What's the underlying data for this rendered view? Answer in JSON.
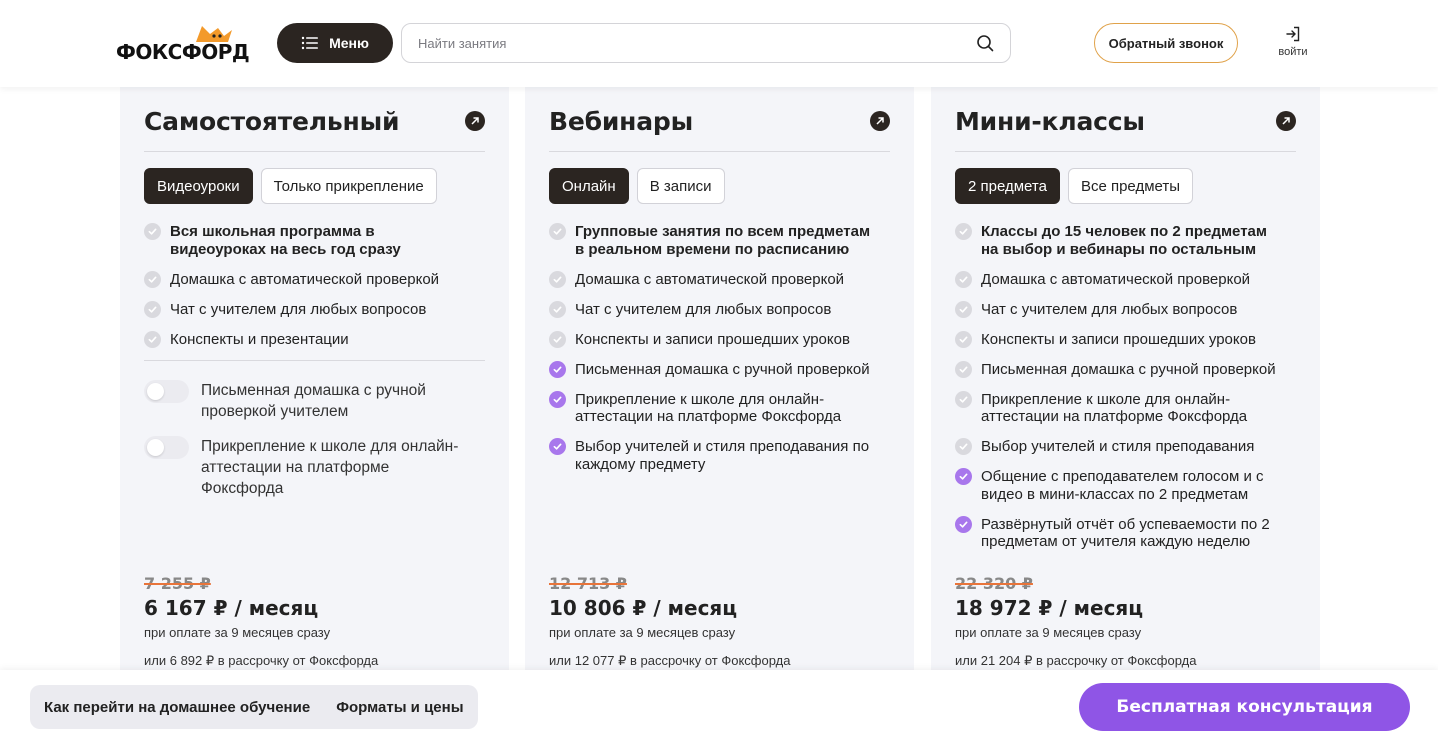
{
  "header": {
    "logo_text": "ФОКСФОРД",
    "menu_label": "Меню",
    "search_placeholder": "Найти занятия",
    "callback_label": "Обратный звонок",
    "login_label": "войти"
  },
  "cards": [
    {
      "title": "Самостоятельный",
      "tabs": [
        {
          "label": "Видеоуроки",
          "active": true
        },
        {
          "label": "Только прикрепление",
          "active": false
        }
      ],
      "features": [
        {
          "text": "Вся школьная программа в видеоуроках на весь год сразу",
          "bold": true,
          "check": "gray"
        },
        {
          "text": "Домашка с автоматической проверкой",
          "bold": false,
          "check": "gray"
        },
        {
          "text": "Чат с учителем для любых вопросов",
          "bold": false,
          "check": "gray"
        },
        {
          "text": "Конспекты и презентации",
          "bold": false,
          "check": "gray"
        }
      ],
      "toggles": [
        {
          "text": "Письменная домашка с ручной проверкой учителем",
          "on": false
        },
        {
          "text": "Прикрепление к школе для онлайн-аттестации на платформе Фоксфорда",
          "on": false
        }
      ],
      "price_old": "7 255 ₽",
      "price_new": "6 167 ₽ / месяц",
      "price_note": "при оплате за 9 месяцев сразу",
      "price_installment": "или 6 892 ₽ в рассрочку от Фоксфорда"
    },
    {
      "title": "Вебинары",
      "tabs": [
        {
          "label": "Онлайн",
          "active": true
        },
        {
          "label": "В записи",
          "active": false
        }
      ],
      "features": [
        {
          "text": "Групповые занятия по всем предметам в реальном времени по расписанию",
          "bold": true,
          "check": "gray"
        },
        {
          "text": "Домашка с автоматической проверкой",
          "bold": false,
          "check": "gray"
        },
        {
          "text": "Чат с учителем для любых вопросов",
          "bold": false,
          "check": "gray"
        },
        {
          "text": "Конспекты и записи прошедших уроков",
          "bold": false,
          "check": "gray"
        },
        {
          "text": "Письменная домашка с ручной проверкой",
          "bold": false,
          "check": "purple"
        },
        {
          "text": "Прикрепление к школе для онлайн-аттестации на платформе Фоксфорда",
          "bold": false,
          "check": "purple"
        },
        {
          "text": "Выбор учителей и стиля преподавания по каждому предмету",
          "bold": false,
          "check": "purple"
        }
      ],
      "price_old": "12 713 ₽",
      "price_new": "10 806 ₽ / месяц",
      "price_note": "при оплате за 9 месяцев сразу",
      "price_installment": "или 12 077 ₽ в рассрочку от Фоксфорда"
    },
    {
      "title": "Мини-классы",
      "tabs": [
        {
          "label": "2 предмета",
          "active": true
        },
        {
          "label": "Все предметы",
          "active": false
        }
      ],
      "features": [
        {
          "text": "Классы до 15 человек по 2 предметам на выбор и вебинары по остальным",
          "bold": true,
          "check": "gray"
        },
        {
          "text": "Домашка с автоматической проверкой",
          "bold": false,
          "check": "gray"
        },
        {
          "text": "Чат с учителем для любых вопросов",
          "bold": false,
          "check": "gray"
        },
        {
          "text": "Конспекты и записи прошедших уроков",
          "bold": false,
          "check": "gray"
        },
        {
          "text": "Письменная домашка с ручной проверкой",
          "bold": false,
          "check": "gray"
        },
        {
          "text": "Прикрепление к школе для онлайн-аттестации на платформе Фоксфорда",
          "bold": false,
          "check": "gray"
        },
        {
          "text": "Выбор учителей и стиля преподавания",
          "bold": false,
          "check": "gray"
        },
        {
          "text": "Общение с преподавателем голосом и с видео в мини-классах по 2 предметам",
          "bold": false,
          "check": "purple"
        },
        {
          "text": "Развёрнутый отчёт об успеваемости по 2 предметам от учителя каждую неделю",
          "bold": false,
          "check": "purple"
        }
      ],
      "price_old": "22 320 ₽",
      "price_new": "18 972 ₽ / месяц",
      "price_note": "при оплате за 9 месяцев сразу",
      "price_installment": "или 21 204 ₽ в рассрочку от Фоксфорда"
    }
  ],
  "bottom_bar": {
    "nav_items": [
      "Как перейти на домашнее обучение",
      "Форматы и цены"
    ],
    "cta_label": "Бесплатная консультация"
  },
  "colors": {
    "dark": "#2b2521",
    "accent_purple": "#8f55e6",
    "check_purple": "#a877ec",
    "check_gray": "#d9d9de",
    "card_bg": "#f4f5f9",
    "callback_border": "#e0a24a"
  }
}
